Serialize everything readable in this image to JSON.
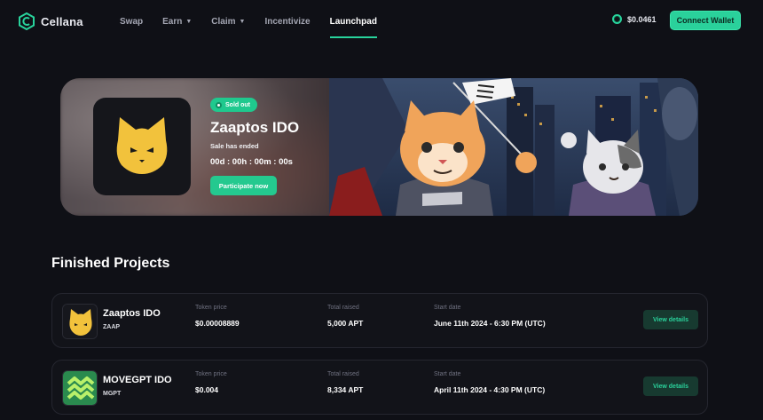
{
  "brand": {
    "name": "Cellana",
    "accent": "#28d39c"
  },
  "nav": {
    "items": [
      {
        "label": "Swap",
        "dropdown": false,
        "active": false
      },
      {
        "label": "Earn",
        "dropdown": true,
        "active": false
      },
      {
        "label": "Claim",
        "dropdown": true,
        "active": false
      },
      {
        "label": "Incentivize",
        "dropdown": false,
        "active": false
      },
      {
        "label": "Launchpad",
        "dropdown": false,
        "active": true
      }
    ],
    "price": "$0.0461",
    "connect_label": "Connect Wallet"
  },
  "hero": {
    "status_badge": "Sold out",
    "title": "Zaaptos IDO",
    "subtitle": "Sale has ended",
    "countdown": "00d : 00h : 00m : 00s",
    "cta_label": "Participate now"
  },
  "finished": {
    "title": "Finished Projects",
    "columns": {
      "price": "Token price",
      "raised": "Total raised",
      "start": "Start date"
    },
    "rows": [
      {
        "name": "Zaaptos IDO",
        "symbol": "ZAAP",
        "price": "$0.00008889",
        "raised": "5,000 APT",
        "start": "June 11th 2024 - 6:30 PM (UTC)",
        "button": "View details",
        "icon": "zaap-cat-icon"
      },
      {
        "name": "MOVEGPT IDO",
        "symbol": "MGPT",
        "price": "$0.004",
        "raised": "8,334 APT",
        "start": "April 11th 2024 - 4:30 PM (UTC)",
        "button": "View details",
        "icon": "movegpt-logo-icon"
      }
    ]
  }
}
